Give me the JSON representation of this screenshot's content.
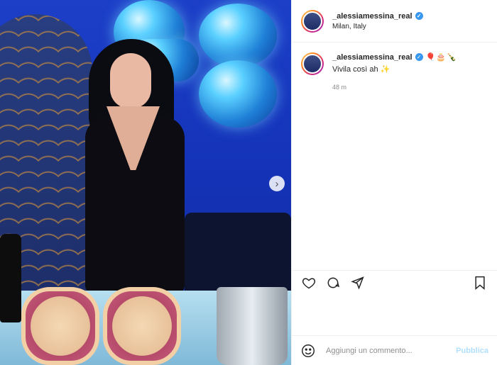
{
  "post": {
    "username": "_alessiamessina_real",
    "location": "Milan, Italy"
  },
  "caption": {
    "username": "_alessiamessina_real",
    "emojis": "🎈🎂🍾",
    "text": "Vivila così ah ✨",
    "time": "48 m"
  },
  "icons": {
    "like": "heart-icon",
    "comment": "comment-bubble-icon",
    "share": "paper-plane-icon",
    "save": "bookmark-icon",
    "emoji": "smiley-icon",
    "next": "chevron-right-icon",
    "verified": "verified-badge-icon"
  },
  "comment_box": {
    "placeholder": "Aggiungi un commento...",
    "publish_label": "Pubblica"
  },
  "colors": {
    "verified": "#3897f0",
    "publish_disabled": "#b2dffc",
    "muted": "#8e8e8e"
  }
}
